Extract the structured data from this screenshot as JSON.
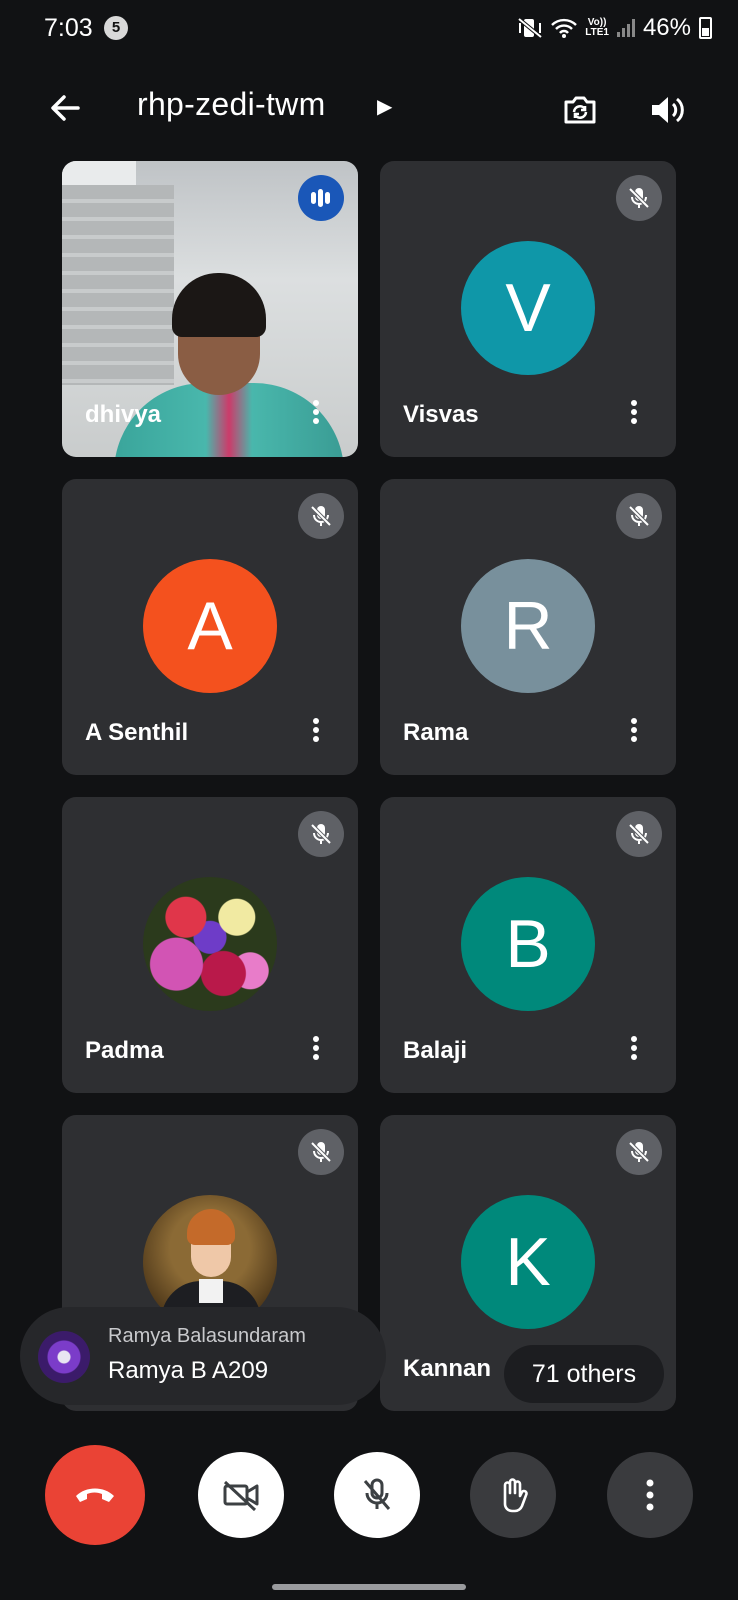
{
  "status_bar": {
    "time": "7:03",
    "notification_count": "5",
    "volte": "Vo))",
    "lte": "LTE1",
    "battery": "46%"
  },
  "header": {
    "meeting_code": "rhp-zedi-twm"
  },
  "participants": [
    {
      "name": "dhivya",
      "type": "video",
      "speaking": true
    },
    {
      "name": "Visvas",
      "initial": "V",
      "color": "#0f97a8",
      "muted": true
    },
    {
      "name": "A Senthil",
      "initial": "A",
      "color": "#f4511e",
      "muted": true
    },
    {
      "name": "Rama",
      "initial": "R",
      "color": "#78909c",
      "muted": true
    },
    {
      "name": "Padma",
      "type": "photo",
      "muted": true
    },
    {
      "name": "Balaji",
      "initial": "B",
      "color": "#00897b",
      "muted": true
    },
    {
      "name": "",
      "type": "photo",
      "muted": true
    },
    {
      "name": "Kannan",
      "initial": "K",
      "color": "#00897b",
      "muted": true
    }
  ],
  "chat_toast": {
    "sender": "Ramya Balasundaram",
    "message": "Ramya B A209"
  },
  "others_count": "71 others",
  "controls": [
    "end-call",
    "camera-off",
    "mic-off",
    "raise-hand",
    "more-options"
  ],
  "colors": {
    "background": "#111214",
    "tile": "#2e2f32",
    "end_call": "#ea4335",
    "speaking": "#1a57b8"
  }
}
